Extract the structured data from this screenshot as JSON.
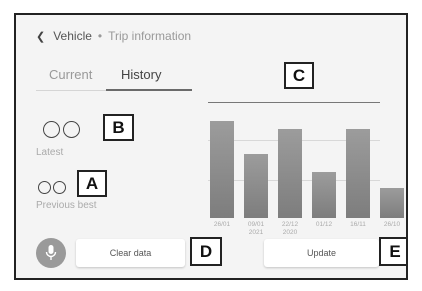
{
  "breadcrumb": {
    "parent": "Vehicle",
    "separator": "•",
    "current": "Trip information"
  },
  "tabs": [
    {
      "label": "Current"
    },
    {
      "label": "History"
    }
  ],
  "stats": {
    "latest": {
      "value": "○○",
      "label": "Latest"
    },
    "previous_best": {
      "value": "○○",
      "label": "Previous best"
    }
  },
  "callouts": {
    "a": "A",
    "b": "B",
    "c": "C",
    "d": "D",
    "e": "E"
  },
  "chart_data": {
    "type": "bar",
    "categories": [
      "26/01",
      "09/01\n2021",
      "22/12\n2020",
      "01/12",
      "16/11",
      "26/10"
    ],
    "values": [
      92,
      61,
      85,
      44,
      85,
      29
    ],
    "ylim": [
      0,
      100
    ],
    "grid": true
  },
  "buttons": {
    "clear_data": "Clear data",
    "update": "Update"
  },
  "icons": {
    "back": "chevron-left-icon",
    "mic": "microphone-icon"
  },
  "colors": {
    "bar": "#8a8a8a",
    "background": "#f4f4f4"
  }
}
